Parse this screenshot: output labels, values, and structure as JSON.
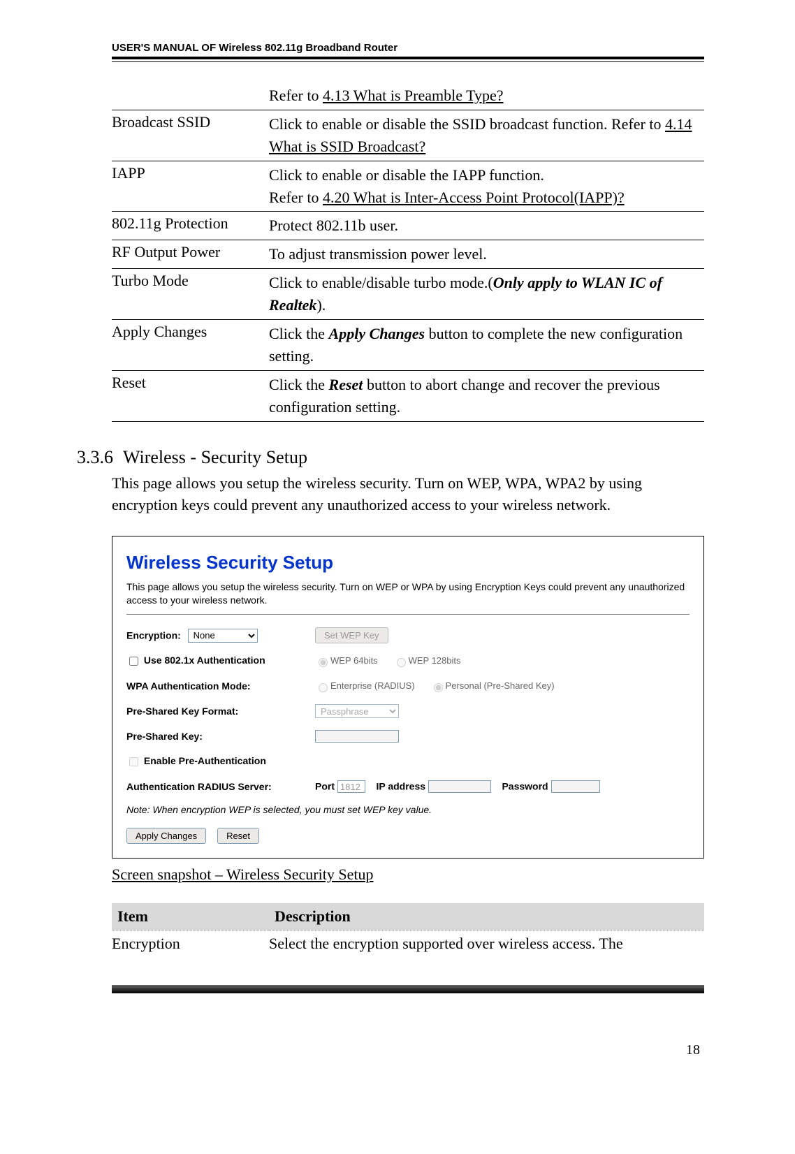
{
  "header": "USER'S MANUAL OF Wireless 802.11g Broadband Router",
  "defs": [
    {
      "term": "",
      "desc_parts": [
        {
          "text": "Refer to ",
          "u": false,
          "bi": false
        },
        {
          "text": "4.13 What is Preamble Type?",
          "u": true,
          "bi": false
        }
      ]
    },
    {
      "term": "Broadcast SSID",
      "desc_parts": [
        {
          "text": "Click to enable or disable the SSID broadcast function. Refer to ",
          "u": false,
          "bi": false
        },
        {
          "text": "4.14 What is SSID Broadcast?",
          "u": true,
          "bi": false
        }
      ]
    },
    {
      "term": "IAPP",
      "desc_parts": [
        {
          "text": "Click to enable or disable the IAPP function.\nRefer to ",
          "u": false,
          "bi": false
        },
        {
          "text": "4.20 What is Inter-Access Point Protocol(IAPP)?",
          "u": true,
          "bi": false
        }
      ]
    },
    {
      "term": "802.11g Protection",
      "desc_parts": [
        {
          "text": "Protect 802.11b user.",
          "u": false,
          "bi": false
        }
      ]
    },
    {
      "term": "RF Output Power",
      "desc_parts": [
        {
          "text": "To adjust transmission power level.",
          "u": false,
          "bi": false
        }
      ]
    },
    {
      "term": "Turbo Mode",
      "desc_parts": [
        {
          "text": "Click to enable/disable turbo mode.(",
          "u": false,
          "bi": false
        },
        {
          "text": "Only apply to WLAN IC of Realtek",
          "u": false,
          "bi": true
        },
        {
          "text": ").",
          "u": false,
          "bi": false
        }
      ]
    },
    {
      "term": "Apply Changes",
      "desc_parts": [
        {
          "text": "Click the ",
          "u": false,
          "bi": false
        },
        {
          "text": "Apply Changes",
          "u": false,
          "bi": true
        },
        {
          "text": " button to complete the new configuration setting.",
          "u": false,
          "bi": false
        }
      ]
    },
    {
      "term": "Reset",
      "desc_parts": [
        {
          "text": "Click the ",
          "u": false,
          "bi": false
        },
        {
          "text": "Reset",
          "u": false,
          "bi": true
        },
        {
          "text": " button to abort change and recover the previous configuration setting.",
          "u": false,
          "bi": false
        }
      ]
    }
  ],
  "section": {
    "num": "3.3.6",
    "title": "Wireless - Security Setup",
    "body": "This page allows you setup the wireless security. Turn on WEP, WPA, WPA2 by using encryption keys could prevent any unauthorized access to your wireless network."
  },
  "screenshot": {
    "title": "Wireless Security Setup",
    "intro": "This page allows you setup the wireless security. Turn on WEP or WPA by using Encryption Keys could prevent any unauthorized access to your wireless network.",
    "encryption_label": "Encryption:",
    "encryption_value": "None",
    "set_wep_btn": "Set WEP Key",
    "use_8021x_label": "Use 802.1x Authentication",
    "wep64_label": "WEP 64bits",
    "wep128_label": "WEP 128bits",
    "wpa_mode_label": "WPA Authentication Mode:",
    "wpa_enterprise_label": "Enterprise (RADIUS)",
    "wpa_personal_label": "Personal (Pre-Shared Key)",
    "psk_format_label": "Pre-Shared Key Format:",
    "psk_format_value": "Passphrase",
    "psk_label": "Pre-Shared Key:",
    "psk_value": "",
    "enable_preauth_label": "Enable Pre-Authentication",
    "radius_label": "Authentication RADIUS Server:",
    "port_label": "Port",
    "port_value": "1812",
    "ip_label": "IP address",
    "ip_value": "",
    "password_label": "Password",
    "password_value": "",
    "note": "Note: When encryption WEP is selected, you must set WEP key value.",
    "apply_btn": "Apply Changes",
    "reset_btn": "Reset"
  },
  "caption": "Screen snapshot – Wireless Security Setup",
  "desc_table": {
    "col1": "Item",
    "col2": "Description",
    "row1_term": "Encryption",
    "row1_desc": "Select the encryption supported over wireless access. The"
  },
  "page_number": "18"
}
